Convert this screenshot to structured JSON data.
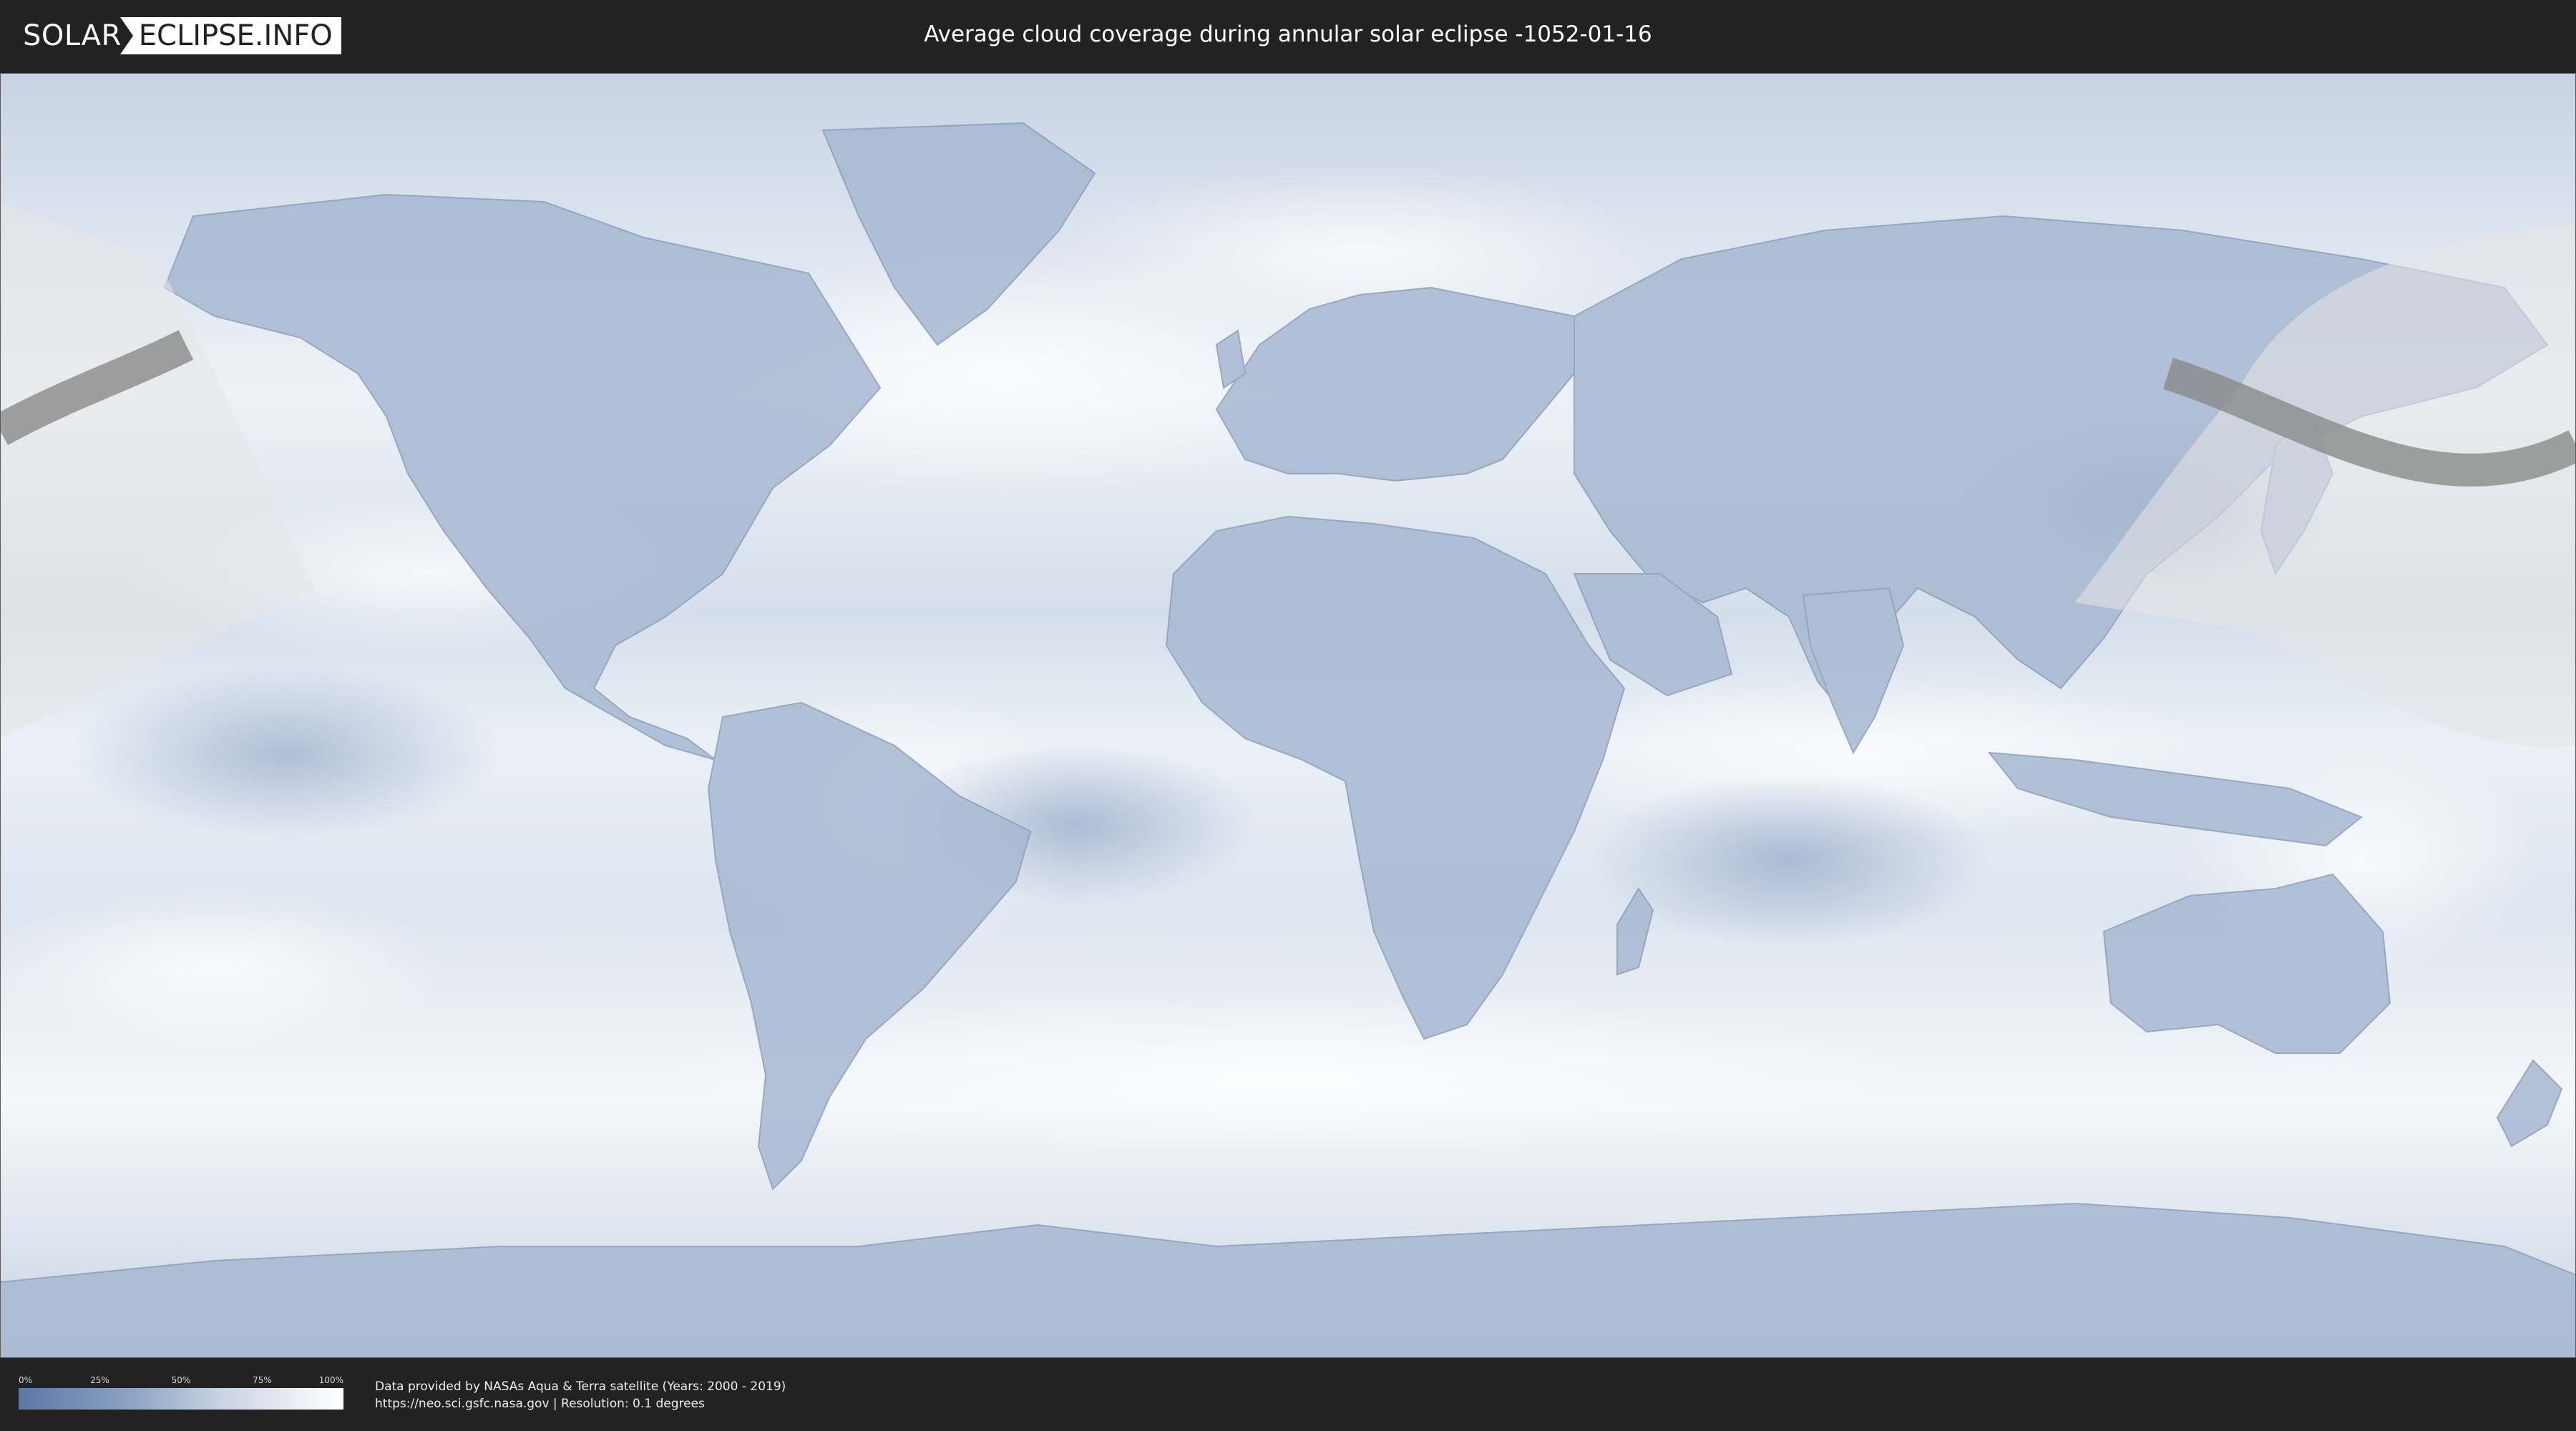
{
  "brand": {
    "logo_left": "SOLAR",
    "logo_right": "ECLIPSE.INFO"
  },
  "title": "Average cloud coverage during annular solar eclipse -1052-01-16",
  "legend": {
    "ticks": [
      "0%",
      "25%",
      "50%",
      "75%",
      "100%"
    ],
    "scale_start_color": "#5d78a6",
    "scale_end_color": "#ffffff"
  },
  "credits": {
    "line1": "Data provided by NASAs Aqua & Terra satellite (Years: 2000 - 2019)",
    "line2": "https://neo.sci.gsfc.nasa.gov | Resolution: 0.1 degrees"
  },
  "colors": {
    "background": "#222222",
    "clear_sky": "#5d78a6",
    "full_cloud": "#ffffff",
    "eclipse_band": "#8a8a8a",
    "eclipse_visibility_zone": "#e6e6e6"
  }
}
